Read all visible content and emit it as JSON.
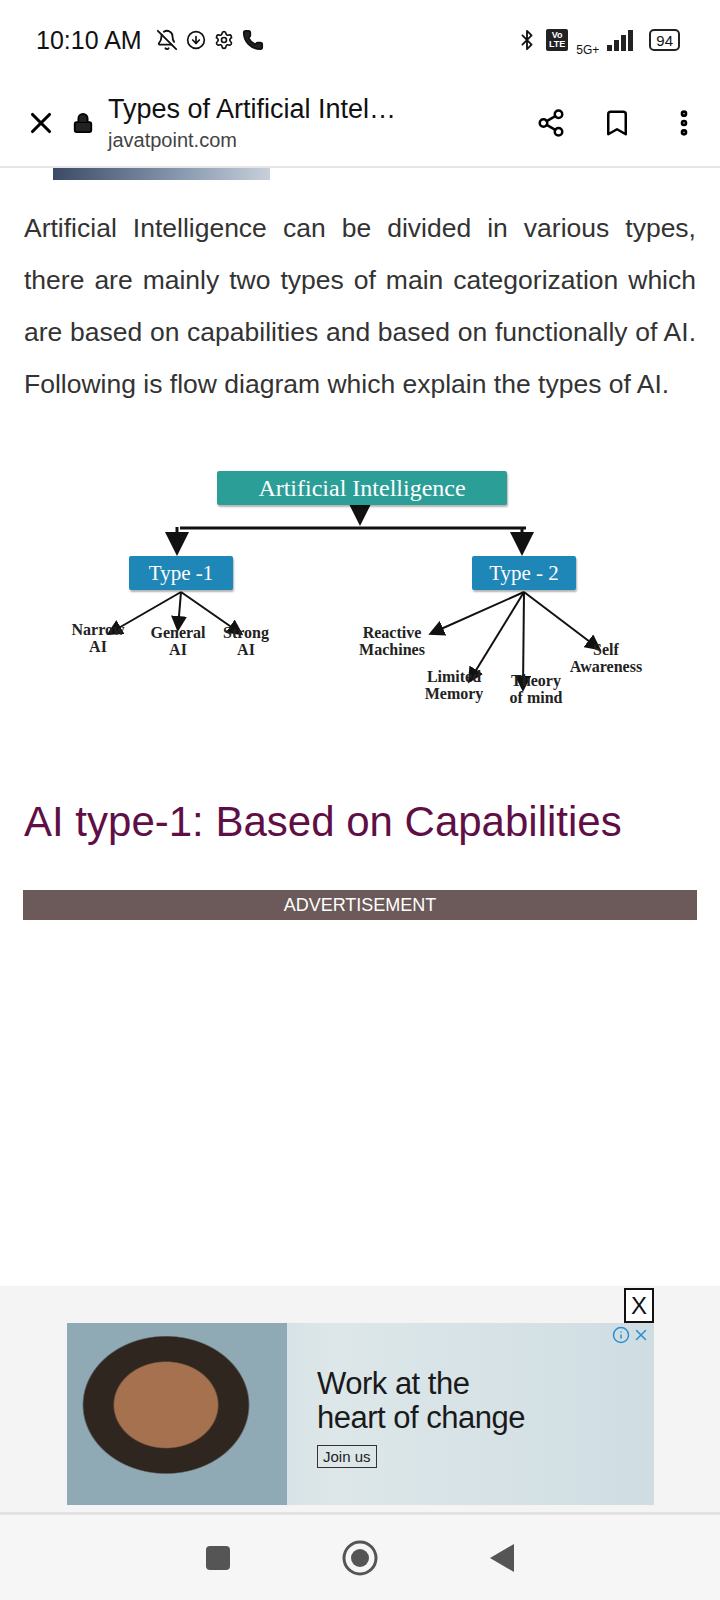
{
  "status_bar": {
    "time": "10:10 AM",
    "volte_badge": "Vo\nLTE",
    "network": "5G+",
    "battery": "94"
  },
  "browser": {
    "title": "Types of Artificial Intel…",
    "url": "javatpoint.com"
  },
  "article": {
    "intro": "Artificial Intelligence can be divided in various types, there are mainly two types of main categorization which are based on capabilities and based on functionally of AI. Following is flow diagram which explain the types of AI.",
    "diagram": {
      "root": "Artificial Intelligence",
      "branches": [
        {
          "label": "Type -1",
          "children": [
            "Narrow\nAI",
            "General\nAI",
            "Strong\nAI"
          ]
        },
        {
          "label": "Type - 2",
          "children": [
            "Reactive\nMachines",
            "Limited\nMemory",
            "Theory\nof mind",
            "Self\nAwareness"
          ]
        }
      ]
    },
    "heading": "AI type-1: Based on Capabilities",
    "ad_label": "ADVERTISEMENT"
  },
  "ad": {
    "headline": "Work at the\nheart of change",
    "button": "Join us",
    "close": "X"
  }
}
